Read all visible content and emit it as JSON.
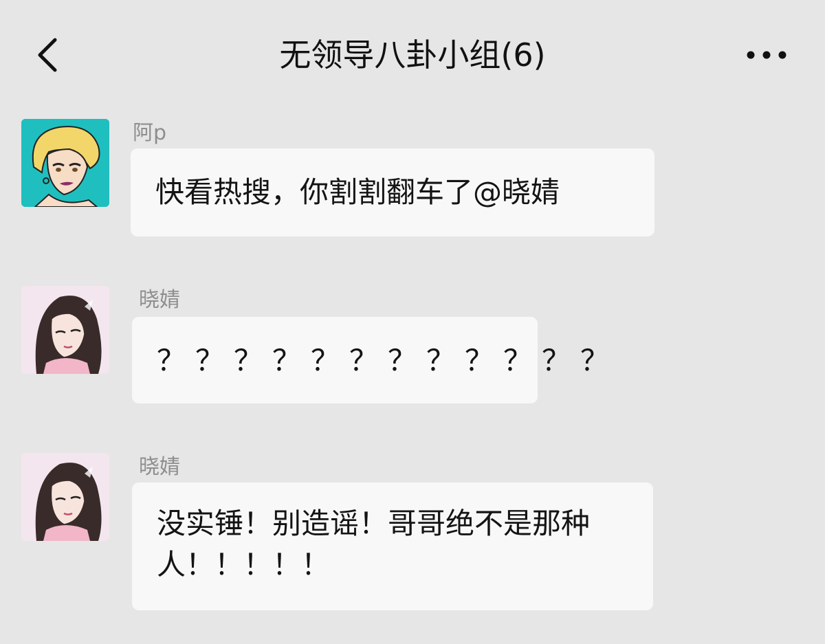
{
  "header": {
    "title": "无领导八卦小组(6)",
    "back_icon": "chevron-left-icon",
    "more_icon": "more-dots-icon"
  },
  "messages": [
    {
      "sender": "阿p",
      "avatar": "blonde-woman-avatar",
      "text": "快看热搜，你割割翻车了@晓婧"
    },
    {
      "sender": "晓婧",
      "avatar": "dark-hair-girl-avatar",
      "text": "？？？？？？？？？？？？"
    },
    {
      "sender": "晓婧",
      "avatar": "dark-hair-girl-avatar",
      "text": "没实锤！别造谣！哥哥绝不是那种人！！！！！"
    }
  ],
  "colors": {
    "background": "#e6e6e6",
    "bubble": "#f8f8f8",
    "sender_name": "#8e8e8e",
    "text": "#141414"
  }
}
